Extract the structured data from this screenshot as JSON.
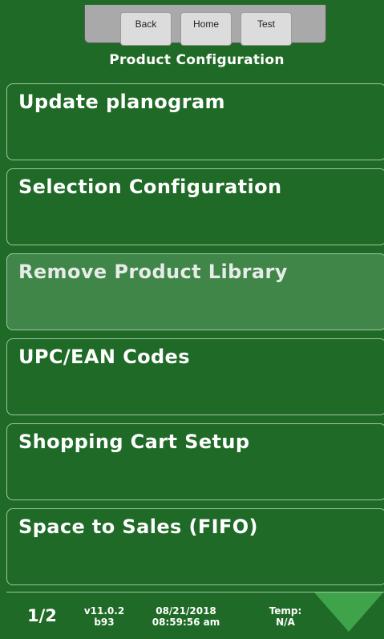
{
  "nav": {
    "back_label": "Back",
    "home_label": "Home",
    "test_label": "Test"
  },
  "page": {
    "title": "Product Configuration"
  },
  "menu": {
    "items": [
      {
        "label": "Update planogram"
      },
      {
        "label": "Selection Configuration"
      },
      {
        "label": "Remove Product Library",
        "selected": true
      },
      {
        "label": "UPC/EAN Codes"
      },
      {
        "label": "Shopping Cart Setup"
      },
      {
        "label": "Space to Sales (FIFO)"
      }
    ]
  },
  "footer": {
    "page_indicator": "1/2",
    "version": "v11.0.2",
    "build": "b93",
    "date": "08/21/2018",
    "time": "08:59:56 am",
    "temp_label": "Temp:",
    "temp_value": "N/A",
    "next_icon": "triangle-down-icon"
  },
  "colors": {
    "background": "#1e6a26",
    "selected_item": "#3f8648",
    "item_border": "#9fc7a3",
    "arrow": "#3fa34b",
    "nav_panel": "#a9a9a9"
  }
}
